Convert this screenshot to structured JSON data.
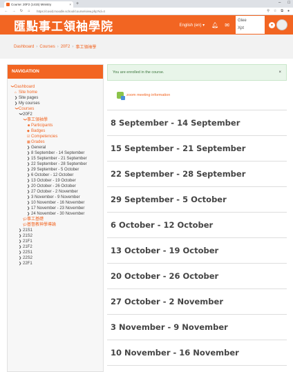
{
  "browser": {
    "tab_title": "Course: 20F2 (1415) Ministry",
    "tab_close": "×",
    "new_tab": "+",
    "url": "https://covid.moodle.school/course/view.php?id=4",
    "win_minimize": "–",
    "win_maximize": "□"
  },
  "header": {
    "site_title": "匯點事工領袖學院",
    "language": "English (en) ▾",
    "user_line1": "Glee",
    "user_line2": "Xpt"
  },
  "breadcrumb": [
    "Dashboard",
    "Courses",
    "20F2",
    "事工領袖學"
  ],
  "breadcrumb_sep": "›",
  "navigation": {
    "header": "NAVIGATION",
    "items": [
      {
        "label": "Dashboard",
        "level": 0,
        "orange": true,
        "icon": "chevron-down"
      },
      {
        "label": "Site home",
        "level": 1,
        "orange": true,
        "icon": "home"
      },
      {
        "label": "Site pages",
        "level": 1,
        "orange": false,
        "icon": "chevron-right"
      },
      {
        "label": "My courses",
        "level": 1,
        "orange": false,
        "icon": "chevron-right"
      },
      {
        "label": "Courses",
        "level": 1,
        "orange": true,
        "icon": "chevron-down"
      },
      {
        "label": "20F2",
        "level": 2,
        "orange": false,
        "icon": "chevron-down"
      },
      {
        "label": "事工領袖學",
        "level": 3,
        "orange": true,
        "icon": "chevron-down"
      },
      {
        "label": "Participants",
        "level": 4,
        "orange": true,
        "icon": "users"
      },
      {
        "label": "Badges",
        "level": 4,
        "orange": true,
        "icon": "badge"
      },
      {
        "label": "Competencies",
        "level": 4,
        "orange": true,
        "icon": "check"
      },
      {
        "label": "Grades",
        "level": 4,
        "orange": true,
        "icon": "table"
      },
      {
        "label": "General",
        "level": 4,
        "orange": false,
        "icon": "chevron-right"
      },
      {
        "label": "8 September - 14 September",
        "level": 4,
        "orange": false,
        "icon": "chevron-right"
      },
      {
        "label": "15 September - 21 September",
        "level": 4,
        "orange": false,
        "icon": "chevron-right"
      },
      {
        "label": "22 September - 28 September",
        "level": 4,
        "orange": false,
        "icon": "chevron-right"
      },
      {
        "label": "29 September - 5 October",
        "level": 4,
        "orange": false,
        "icon": "chevron-right"
      },
      {
        "label": "6 October - 12 October",
        "level": 4,
        "orange": false,
        "icon": "chevron-right"
      },
      {
        "label": "13 October - 19 October",
        "level": 4,
        "orange": false,
        "icon": "chevron-right"
      },
      {
        "label": "20 October - 26 October",
        "level": 4,
        "orange": false,
        "icon": "chevron-right"
      },
      {
        "label": "27 October - 2 November",
        "level": 4,
        "orange": false,
        "icon": "chevron-right"
      },
      {
        "label": "3 November - 9 November",
        "level": 4,
        "orange": false,
        "icon": "chevron-right"
      },
      {
        "label": "10 November - 16 November",
        "level": 4,
        "orange": false,
        "icon": "chevron-right"
      },
      {
        "label": "17 November - 23 November",
        "level": 4,
        "orange": false,
        "icon": "chevron-right"
      },
      {
        "label": "24 November - 30 November",
        "level": 4,
        "orange": false,
        "icon": "chevron-right"
      },
      {
        "label": "事工基礎",
        "level": 3,
        "orange": true,
        "icon": "graduation-cap"
      },
      {
        "label": "基督教神學導論",
        "level": 3,
        "orange": true,
        "icon": "graduation-cap"
      },
      {
        "label": "21S1",
        "level": 2,
        "orange": false,
        "icon": "chevron-right"
      },
      {
        "label": "21S2",
        "level": 2,
        "orange": false,
        "icon": "chevron-right"
      },
      {
        "label": "21F1",
        "level": 2,
        "orange": false,
        "icon": "chevron-right"
      },
      {
        "label": "21F2",
        "level": 2,
        "orange": false,
        "icon": "chevron-right"
      },
      {
        "label": "22S1",
        "level": 2,
        "orange": false,
        "icon": "chevron-right"
      },
      {
        "label": "22S2",
        "level": 2,
        "orange": false,
        "icon": "chevron-right"
      },
      {
        "label": "22F1",
        "level": 2,
        "orange": false,
        "icon": "chevron-right"
      }
    ]
  },
  "main": {
    "alert": "You are enrolled in the course.",
    "alert_close": "×",
    "zoom_link": "zoom meeting information",
    "weeks": [
      "8 September - 14 September",
      "15 September - 21 September",
      "22 September - 28 September",
      "29 September - 5 October",
      "6 October - 12 October",
      "13 October - 19 October",
      "20 October - 26 October",
      "27 October - 2 November",
      "3 November - 9 November",
      "10 November - 16 November"
    ]
  },
  "colors": {
    "accent": "#f26522"
  }
}
